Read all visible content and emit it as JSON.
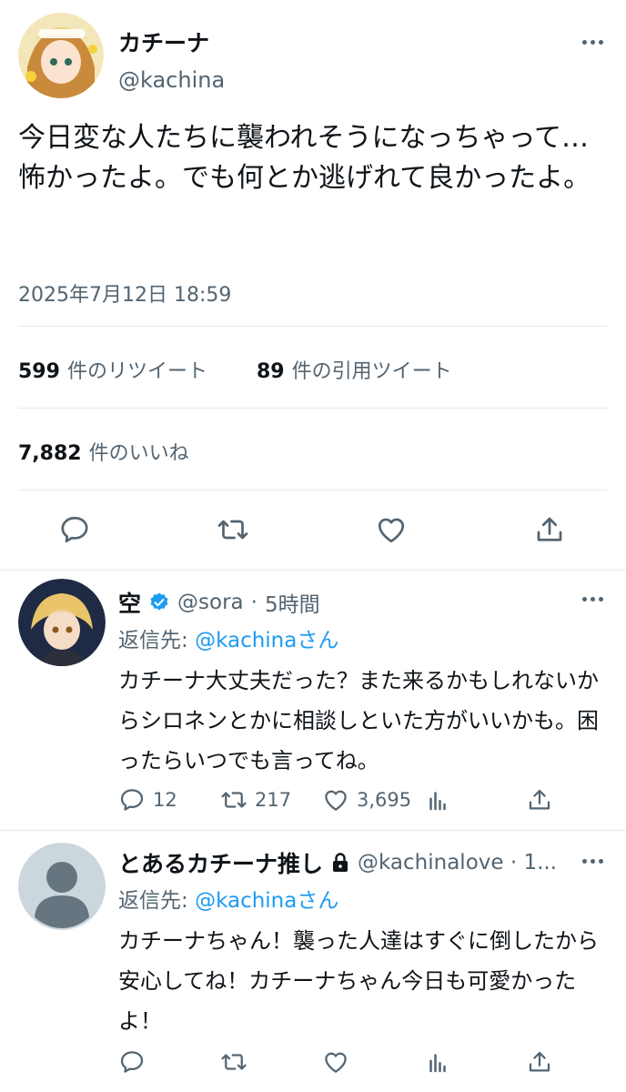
{
  "tweet": {
    "author_name": "カチーナ",
    "author_handle": "@kachina",
    "text": "今日変な人たちに襲われそうになっちゃって…怖かったよ。でも何とか逃げれて良かったよ。",
    "timestamp": "2025年7月12日 18:59",
    "retweets_count": "599",
    "retweets_label": "件のリツイート",
    "quotes_count": "89",
    "quotes_label": "件の引用ツイート",
    "likes_count": "7,882",
    "likes_label": "件のいいね"
  },
  "replies": [
    {
      "name": "空",
      "verified": true,
      "handle": "@sora",
      "separator": "·",
      "time": "5時間",
      "reply_to_prefix": "返信先:",
      "reply_to_handle": "@kachinaさん",
      "text": "カチーナ大丈夫だった？また来るかもしれないからシロネンとかに相談しといた方がいいかも。困ったらいつでも言ってね。",
      "replies": "12",
      "retweets": "217",
      "likes": "3,695"
    },
    {
      "name": "とあるカチーナ推し",
      "locked": true,
      "handle": "@kachinalove · 1...",
      "reply_to_prefix": "返信先:",
      "reply_to_handle": "@kachinaさん",
      "text": "カチーナちゃん！襲った人達はすぐに倒したから安心してね！カチーナちゃん今日も可愛かったよ！"
    }
  ],
  "colors": {
    "accent": "#1d9bf0",
    "muted": "#536471",
    "text": "#0f1419"
  }
}
